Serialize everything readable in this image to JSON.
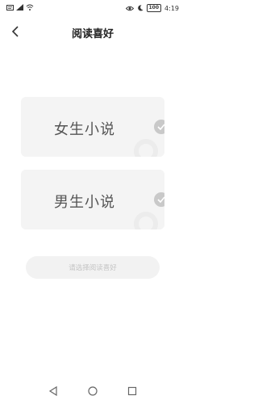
{
  "status_bar": {
    "left_icons": [
      "message-icon",
      "signal-icon",
      "wifi-icon"
    ],
    "right_icons": [
      "eye-icon",
      "moon-icon"
    ],
    "battery": "100",
    "time": "4:19"
  },
  "header": {
    "title": "阅读喜好",
    "back_icon": "chevron-left-icon"
  },
  "options": [
    {
      "label": "女生小说",
      "selected": false,
      "check_icon": "check-circle-icon"
    },
    {
      "label": "男生小说",
      "selected": false,
      "check_icon": "check-circle-icon"
    }
  ],
  "confirm_button": {
    "label": "请选择阅读喜好",
    "enabled": false
  },
  "system_nav": [
    "back-triangle-icon",
    "home-circle-icon",
    "recents-square-icon"
  ],
  "colors": {
    "card_bg": "#f4f4f4",
    "check_bg": "#c9c9c9",
    "button_bg": "#f2f2f2",
    "button_text": "#c4c4c4"
  }
}
